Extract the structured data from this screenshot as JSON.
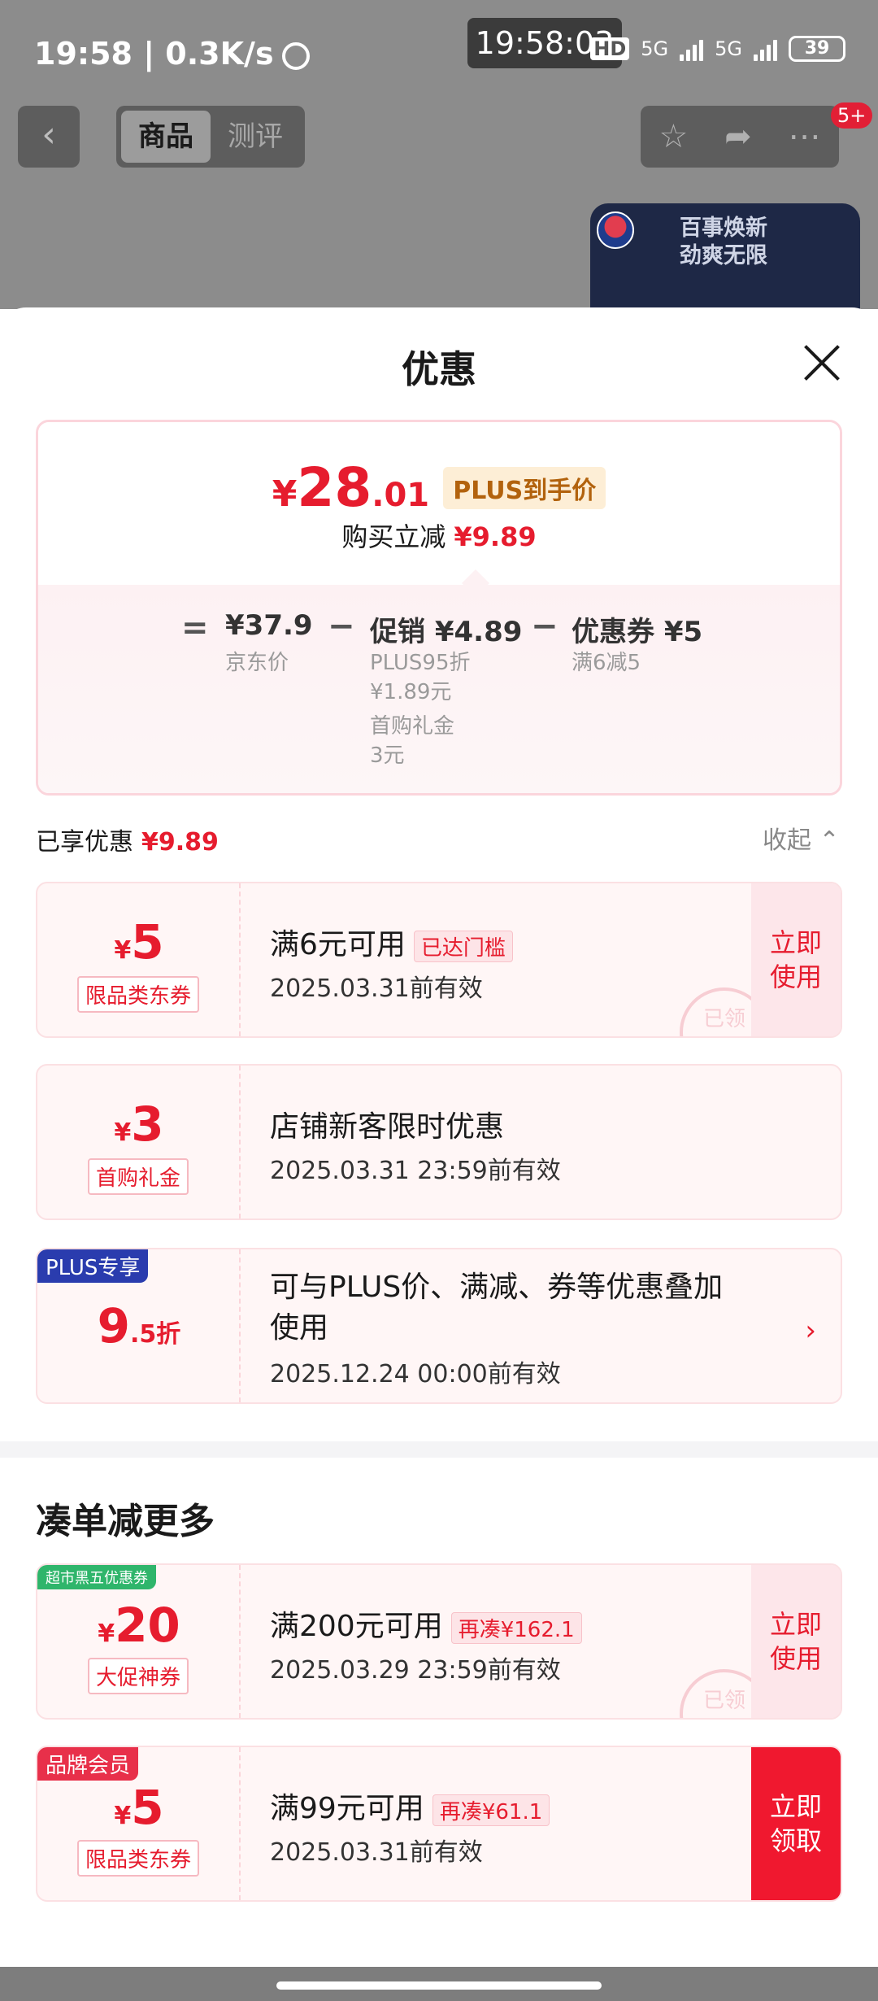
{
  "status_bar": {
    "time": "19:58 | 0.3K/s",
    "center_clock": "19:58:03",
    "network1": "HD",
    "network2": "5G",
    "network3": "5G",
    "battery": "39"
  },
  "topnav": {
    "back_icon": "chevron-left-icon",
    "tabs": [
      {
        "label": "商品"
      },
      {
        "label": "测评"
      }
    ],
    "badge": "5+"
  },
  "promo": {
    "text": "百事焕新\n劲爽无限",
    "text_line1": "百事焕新",
    "text_line2": "劲爽无限"
  },
  "sheet": {
    "title": "优惠",
    "summary": {
      "price_symbol": "¥",
      "price_int": "28",
      "price_dec": ".01",
      "plus_tag": "PLUS到手价",
      "reduce_label": "购买立减",
      "reduce_value": "¥9.89",
      "eq": "=",
      "jd_price": "¥37.9",
      "jd_label": "京东价",
      "minus1": "−",
      "promo_label": "促销 ¥4.89",
      "promo_sub1": "PLUS95折",
      "promo_sub2": "¥1.89元",
      "promo_sub3": "首购礼金",
      "promo_sub4": "3元",
      "minus2": "−",
      "coupon_label": "优惠券 ¥5",
      "coupon_sub": "满6减5"
    },
    "enjoyed_label": "已享优惠",
    "enjoyed_value": "¥9.89",
    "collapse_label": "收起",
    "coupons": [
      {
        "cur": "¥",
        "amount": "5",
        "type": "限品类东券",
        "cond": "满6元可用",
        "tag": "已达门槛",
        "valid": "2025.03.31前有效",
        "action": "立即\n使用",
        "action_l1": "立即",
        "action_l2": "使用",
        "stamp": "已领"
      },
      {
        "cur": "¥",
        "amount": "3",
        "type": "首购礼金",
        "cond": "店铺新客限时优惠",
        "valid": "2025.03.31 23:59前有效"
      },
      {
        "corner": "PLUS专享",
        "amount": "9",
        "amount_dec": ".5折",
        "cond_l1": "可与PLUS价、满减、券等优惠叠加",
        "cond_l2": "使用",
        "valid": "2025.12.24 00:00前有效"
      }
    ],
    "more_title": "凑单减更多",
    "more_coupons": [
      {
        "corner": "超市黑五优惠券",
        "cur": "¥",
        "amount": "20",
        "type": "大促神券",
        "cond": "满200元可用",
        "tag": "再凑¥162.1",
        "valid": "2025.03.29 23:59前有效",
        "action_l1": "立即",
        "action_l2": "使用",
        "stamp": "已领"
      },
      {
        "corner": "品牌会员",
        "cur": "¥",
        "amount": "5",
        "type": "限品类东券",
        "cond": "满99元可用",
        "tag": "再凑¥61.1",
        "valid": "2025.03.31前有效",
        "action_l1": "立即",
        "action_l2": "领取"
      }
    ]
  },
  "colors": {
    "accent": "#e61c2e",
    "plus_blue": "#2a3cae",
    "green_corner": "#2fb56b",
    "sheet_bg": "#ffffff"
  }
}
